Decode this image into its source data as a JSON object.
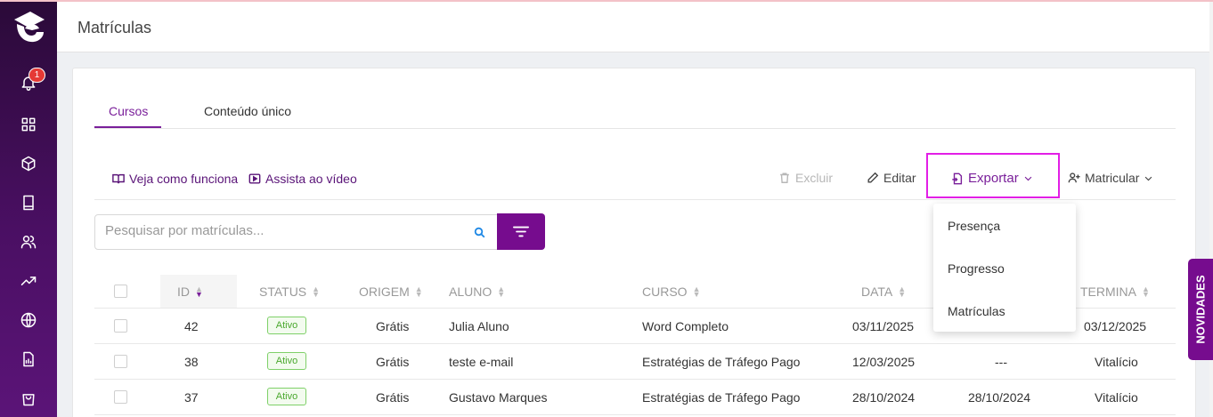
{
  "page": {
    "title": "Matrículas"
  },
  "sidebar": {
    "notification_count": "1"
  },
  "tabs": [
    {
      "label": "Cursos",
      "active": true
    },
    {
      "label": "Conteúdo único",
      "active": false
    }
  ],
  "toolbar": {
    "how_it_works": "Veja como funciona",
    "watch_video": "Assista ao vídeo",
    "delete": "Excluir",
    "edit": "Editar",
    "export": "Exportar",
    "enroll": "Matricular"
  },
  "search": {
    "placeholder": "Pesquisar por matrículas..."
  },
  "table": {
    "headers": {
      "id": "ID",
      "status": "STATUS",
      "origin": "ORIGEM",
      "student": "ALUNO",
      "course": "CURSO",
      "date": "DATA",
      "ends": "TERMINA"
    },
    "rows": [
      {
        "id": "42",
        "status": "Ativo",
        "origin": "Grátis",
        "student": "Julia Aluno",
        "course": "Word Completo",
        "date": "03/11/2025",
        "col7": "",
        "ends": "03/12/2025"
      },
      {
        "id": "38",
        "status": "Ativo",
        "origin": "Grátis",
        "student": "teste e-mail",
        "course": "Estratégias de Tráfego Pago",
        "date": "12/03/2025",
        "col7": "---",
        "ends": "Vitalício"
      },
      {
        "id": "37",
        "status": "Ativo",
        "origin": "Grátis",
        "student": "Gustavo Marques",
        "course": "Estratégias de Tráfego Pago",
        "date": "28/10/2024",
        "col7": "28/10/2024",
        "ends": "Vitalício"
      }
    ]
  },
  "export_menu": {
    "items": [
      "Presença",
      "Progresso",
      "Matrículas"
    ]
  },
  "novidades": "NOVIDADES",
  "colors": {
    "primary": "#760c8e",
    "accent_text": "#7a1f9a",
    "highlight_border": "#e21ee6",
    "active_badge": "#49a82d"
  }
}
